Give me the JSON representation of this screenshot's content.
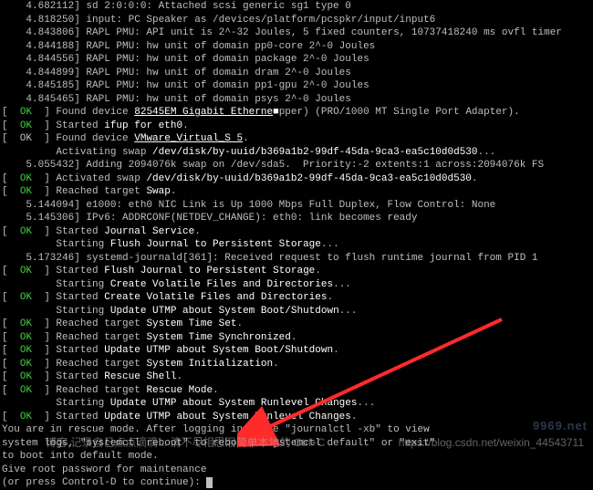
{
  "kernel": [
    "    4.682112] sd 2:0:0:0: Attached scsi generic sg1 type 0",
    "    4.818250] input: PC Speaker as /devices/platform/pcspkr/input/input6",
    "    4.843806] RAPL PMU: API unit is 2^-32 Joules, 5 fixed counters, 10737418240 ms ovfl timer",
    "    4.844188] RAPL PMU: hw unit of domain pp0-core 2^-0 Joules",
    "    4.844556] RAPL PMU: hw unit of domain package 2^-0 Joules",
    "    4.844899] RAPL PMU: hw unit of domain dram 2^-0 Joules",
    "    4.845185] RAPL PMU: hw unit of domain pp1-gpu 2^-0 Joules",
    "    4.845465] RAPL PMU: hw unit of domain psys 2^-0 Joules"
  ],
  "e": [
    {
      "type": "ok",
      "lead": "Found device ",
      "hi": "82545EM Gigabit Etherne",
      "tail": "pper) (PRO/1000 MT Single Port Adapter).",
      "ul": true,
      "block": "■"
    },
    {
      "type": "ok",
      "lead": "Started ",
      "hi": "ifup for eth0",
      "tail": "."
    },
    {
      "type": "plain",
      "lead": "Found device ",
      "hi": "VMware_Virtual_S 5",
      "tail": ".",
      "ul": true
    },
    {
      "type": "cont",
      "lead": "Activating swap ",
      "hi": "/dev/disk/by-uuid/b369a1b2-99df-45da-9ca3-ea5c10d0d530",
      "tail": "..."
    },
    {
      "type": "k",
      "text": "    5.055432] Adding 2094076k swap on /dev/sda5.  Priority:-2 extents:1 across:2094076k FS"
    },
    {
      "type": "ok",
      "lead": "Activated swap ",
      "hi": "/dev/disk/by-uuid/b369a1b2-99df-45da-9ca3-ea5c10d0d530",
      "tail": "."
    },
    {
      "type": "ok",
      "lead": "Reached target ",
      "hi": "Swap",
      "tail": "."
    },
    {
      "type": "k",
      "text": "    5.144094] e1000: eth0 NIC Link is Up 1000 Mbps Full Duplex, Flow Control: None"
    },
    {
      "type": "k",
      "text": "    5.145306] IPv6: ADDRCONF(NETDEV_CHANGE): eth0: link becomes ready"
    },
    {
      "type": "ok",
      "lead": "Started ",
      "hi": "Journal Service",
      "tail": "."
    },
    {
      "type": "cont",
      "lead": "Starting ",
      "hi": "Flush Journal to Persistent Storage",
      "tail": "..."
    },
    {
      "type": "k",
      "text": "    5.173246] systemd-journald[361]: Received request to flush runtime journal from PID 1"
    },
    {
      "type": "ok",
      "lead": "Started ",
      "hi": "Flush Journal to Persistent Storage",
      "tail": "."
    },
    {
      "type": "cont",
      "lead": "Starting ",
      "hi": "Create Volatile Files and Directories",
      "tail": "..."
    },
    {
      "type": "ok",
      "lead": "Started ",
      "hi": "Create Volatile Files and Directories",
      "tail": "."
    },
    {
      "type": "cont",
      "lead": "Starting ",
      "hi": "Update UTMP about System Boot/Shutdown",
      "tail": "..."
    },
    {
      "type": "ok",
      "lead": "Reached target ",
      "hi": "System Time Set",
      "tail": "."
    },
    {
      "type": "ok",
      "lead": "Reached target ",
      "hi": "System Time Synchronized",
      "tail": "."
    },
    {
      "type": "ok",
      "lead": "Started ",
      "hi": "Update UTMP about System Boot/Shutdown",
      "tail": "."
    },
    {
      "type": "ok",
      "lead": "Reached target ",
      "hi": "System Initialization",
      "tail": "."
    },
    {
      "type": "ok",
      "lead": "Started ",
      "hi": "Rescue Shell",
      "tail": "."
    },
    {
      "type": "ok",
      "lead": "Reached target ",
      "hi": "Rescue Mode",
      "tail": "."
    },
    {
      "type": "cont",
      "lead": "Starting ",
      "hi": "Update UTMP about System Runlevel Changes",
      "tail": "..."
    },
    {
      "type": "ok",
      "lead": "Started ",
      "hi": "Update UTMP about System Runlevel Changes",
      "tail": "."
    }
  ],
  "msg": {
    "l1": "You are in rescue mode. After logging in, type \"journalctl -xb\" to view",
    "l2": "system logs, \"systemctl reboot\" to reboot, \"systemctl default\" or \"exit\"",
    "l3": "to boot into default mode.",
    "l4": "Give root password for maintenance",
    "l5": "(or press Control-D to continue): "
  },
  "wm": {
    "left": "博客,记录自己点点滴滴...  清不尽相思泪简单本地的 Ctrl+C",
    "right": "https://blog.csdn.net/weixin_44543711",
    "logo": "9969.net"
  }
}
